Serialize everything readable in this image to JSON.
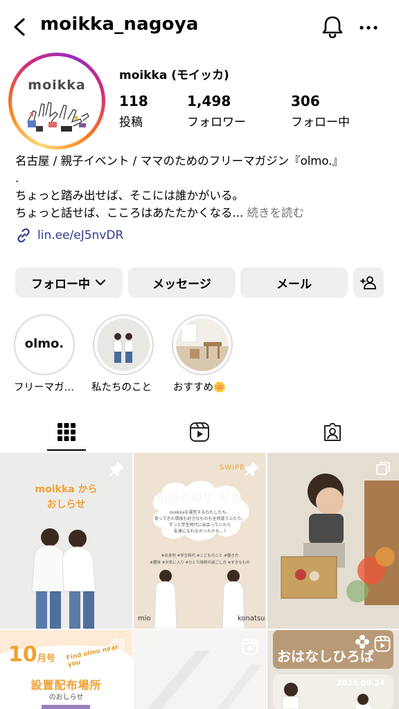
{
  "header": {
    "username": "moikka_nagoya",
    "icons": [
      "back-arrow-icon",
      "bell-icon",
      "more-dots-icon"
    ]
  },
  "profile": {
    "avatar_text": "moikka",
    "display_name": "moikka (モイッカ)",
    "stats": [
      {
        "value": "118",
        "label": "投稿"
      },
      {
        "value": "1,498",
        "label": "フォロワー"
      },
      {
        "value": "306",
        "label": "フォロー中"
      }
    ],
    "bio_lines": [
      "名古屋 / 親子イベント / ママのためのフリーマガジン『olmo.』",
      ".",
      "ちょっと踏み出せば、そこには誰かがいる。",
      "ちょっと話せば、こころはあたたかくなる..."
    ],
    "bio_more": "続きを読む",
    "link": "lin.ee/eJ5nvDR"
  },
  "actions": {
    "following": "フォロー中",
    "message": "メッセージ",
    "mail": "メール"
  },
  "highlights": [
    {
      "label": "フリーマガ…",
      "cover_text": "olmo."
    },
    {
      "label": "私たちのこと"
    },
    {
      "label": "おすすめ🌼"
    }
  ],
  "tabs": [
    "grid-icon",
    "reels-icon",
    "tagged-icon"
  ],
  "posts": {
    "p1": {
      "line1": "moikka から",
      "line2": "おしらせ"
    },
    "p2": {
      "swipe": "SWIPE",
      "title": "ABOUT US",
      "text1": "moikkaを運営するわたしたち。",
      "text2": "育ってきた環境も好きなものも全然違うふたり。",
      "text3": "ずっと学生時代に出会っていたら",
      "text4": "友達になれなかったかも…?",
      "tags1": "#出身地  #学生時代  #こどものこと  #働き方",
      "tags2": "#趣味  #お気に入り  #ひとり時間の過ごし方  #すきなもの",
      "name_left": "mio",
      "name_right": "konatsu"
    },
    "p4": {
      "month": "10",
      "month_suffix": "月号",
      "find": "Find olmo near you",
      "title": "設置配布場所",
      "sub": "のおしらせ"
    },
    "p6": {
      "title": "おはなしひろば",
      "date": "2025.09.24"
    }
  }
}
